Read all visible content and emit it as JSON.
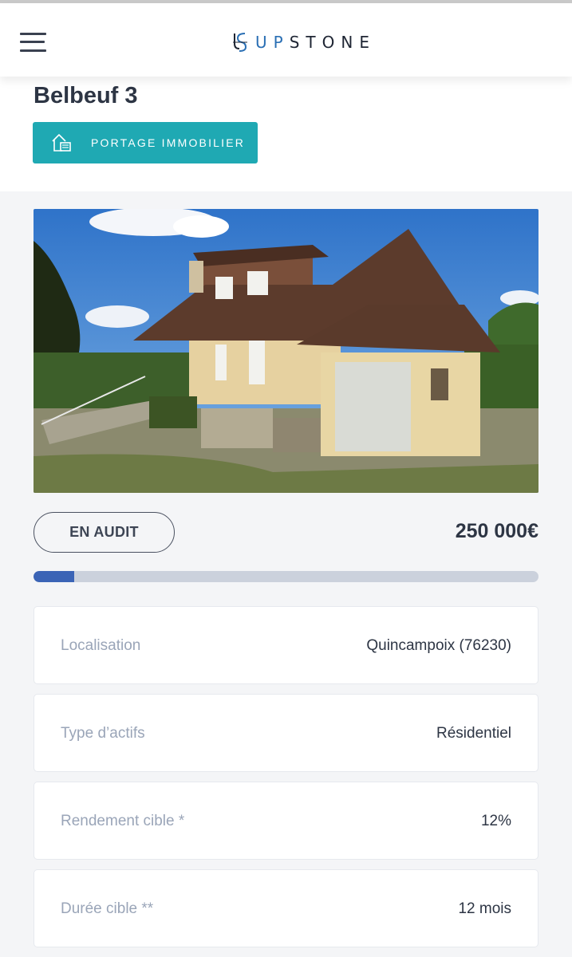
{
  "app": {
    "logo_text_a": "UP",
    "logo_text_b": "STONE",
    "brand_color": "#1fa9b3",
    "accent_color": "#3b64b6"
  },
  "header": {
    "menu_icon": "hamburger-menu-icon"
  },
  "property": {
    "title": "Belbeuf 3",
    "category": {
      "label": "PORTAGE IMMOBILIER",
      "icon": "building-icon"
    },
    "status": "EN AUDIT",
    "price": "250 000€",
    "funding_progress": 0.08
  },
  "details": [
    {
      "label": "Localisation",
      "value": "Quincampoix (76230)"
    },
    {
      "label": "Type d’actifs",
      "value": "Résidentiel"
    },
    {
      "label": "Rendement cible *",
      "value": "12%"
    },
    {
      "label": "Durée cible  **",
      "value": "12 mois"
    }
  ]
}
